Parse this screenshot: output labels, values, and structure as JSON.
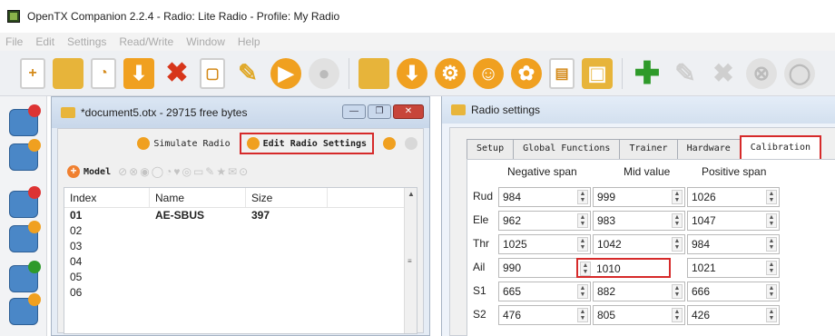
{
  "app": {
    "title": "OpenTX Companion 2.2.4 - Radio: Lite Radio - Profile: My Radio"
  },
  "menu": [
    "File",
    "Edit",
    "Settings",
    "Read/Write",
    "Window",
    "Help"
  ],
  "toolbar_icons": [
    "new-document-icon",
    "open-folder-icon",
    "open-document-icon",
    "save-icon",
    "delete-icon",
    "document-icon",
    "edit-pencil-icon",
    "circle-arrow-icon",
    "disabled-circle-icon",
    "folder-settings-icon",
    "download-icon",
    "gear-icon",
    "profile-icon",
    "palette-icon",
    "chart-document-icon",
    "write-icon",
    "add-icon",
    "pencil-gray-icon",
    "delete-gray-icon",
    "disabled-icon",
    "disabled-icon-2"
  ],
  "document": {
    "title": "*document5.otx - 29715 free bytes",
    "simulate_label": "Simulate Radio",
    "edit_label": "Edit Radio Settings",
    "model_label": "Model",
    "columns": [
      "Index",
      "Name",
      "Size"
    ],
    "rows": [
      {
        "index": "01",
        "name": "AE-SBUS",
        "size": "397"
      },
      {
        "index": "02",
        "name": "",
        "size": ""
      },
      {
        "index": "03",
        "name": "",
        "size": ""
      },
      {
        "index": "04",
        "name": "",
        "size": ""
      },
      {
        "index": "05",
        "name": "",
        "size": ""
      },
      {
        "index": "06",
        "name": "",
        "size": ""
      }
    ]
  },
  "radio": {
    "title": "Radio settings",
    "tabs": [
      "Setup",
      "Global Functions",
      "Trainer",
      "Hardware",
      "Calibration"
    ],
    "active_tab": "Calibration",
    "columns": [
      "Negative span",
      "Mid value",
      "Positive span"
    ],
    "rows": [
      {
        "label": "Rud",
        "neg": "984",
        "mid": "999",
        "pos": "1026"
      },
      {
        "label": "Ele",
        "neg": "962",
        "mid": "983",
        "pos": "1047"
      },
      {
        "label": "Thr",
        "neg": "1025",
        "mid": "1042",
        "pos": "984"
      },
      {
        "label": "Ail",
        "neg": "990",
        "mid": "1010",
        "pos": "1021"
      },
      {
        "label": "S1",
        "neg": "665",
        "mid": "882",
        "pos": "666"
      },
      {
        "label": "S2",
        "neg": "476",
        "mid": "805",
        "pos": "426"
      }
    ]
  },
  "colors": {
    "highlight": "#d62a2a",
    "accent": "#f0a020"
  }
}
